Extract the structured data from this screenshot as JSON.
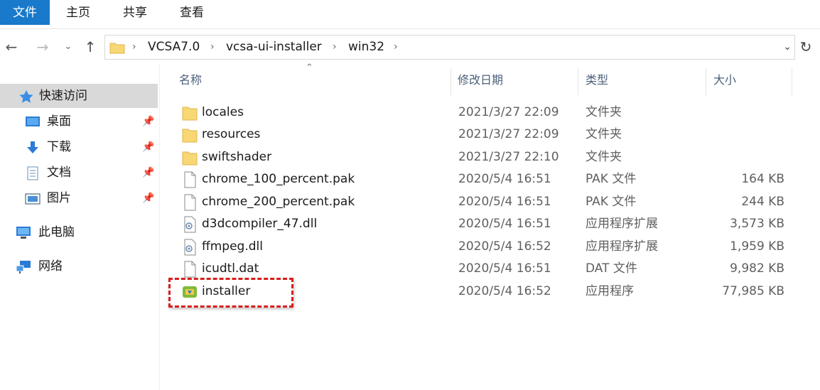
{
  "ribbon": {
    "tabs": [
      {
        "label": "文件"
      },
      {
        "label": "主页"
      },
      {
        "label": "共享"
      },
      {
        "label": "查看"
      }
    ]
  },
  "address": {
    "crumbs": [
      "VCSA7.0",
      "vcsa-ui-installer",
      "win32"
    ]
  },
  "sidebar": {
    "quick_access": "快速访问",
    "items": [
      {
        "label": "桌面",
        "icon": "desktop-icon"
      },
      {
        "label": "下载",
        "icon": "download-icon"
      },
      {
        "label": "文档",
        "icon": "document-icon"
      },
      {
        "label": "图片",
        "icon": "picture-icon"
      }
    ],
    "this_pc": "此电脑",
    "network": "网络"
  },
  "columns": {
    "name": "名称",
    "date": "修改日期",
    "type": "类型",
    "size": "大小"
  },
  "files": [
    {
      "name": "locales",
      "date": "2021/3/27 22:09",
      "type": "文件夹",
      "size": "",
      "icon": "folder-icon"
    },
    {
      "name": "resources",
      "date": "2021/3/27 22:09",
      "type": "文件夹",
      "size": "",
      "icon": "folder-icon"
    },
    {
      "name": "swiftshader",
      "date": "2021/3/27 22:10",
      "type": "文件夹",
      "size": "",
      "icon": "folder-icon"
    },
    {
      "name": "chrome_100_percent.pak",
      "date": "2020/5/4 16:51",
      "type": "PAK 文件",
      "size": "164 KB",
      "icon": "file-icon"
    },
    {
      "name": "chrome_200_percent.pak",
      "date": "2020/5/4 16:51",
      "type": "PAK 文件",
      "size": "244 KB",
      "icon": "file-icon"
    },
    {
      "name": "d3dcompiler_47.dll",
      "date": "2020/5/4 16:51",
      "type": "应用程序扩展",
      "size": "3,573 KB",
      "icon": "dll-icon"
    },
    {
      "name": "ffmpeg.dll",
      "date": "2020/5/4 16:52",
      "type": "应用程序扩展",
      "size": "1,959 KB",
      "icon": "dll-icon"
    },
    {
      "name": "icudtl.dat",
      "date": "2020/5/4 16:51",
      "type": "DAT 文件",
      "size": "9,982 KB",
      "icon": "file-icon"
    },
    {
      "name": "installer",
      "date": "2020/5/4 16:52",
      "type": "应用程序",
      "size": "77,985 KB",
      "icon": "installer-icon"
    }
  ]
}
